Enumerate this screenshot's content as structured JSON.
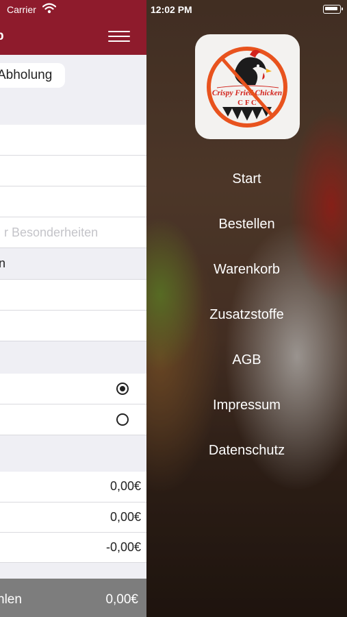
{
  "status": {
    "carrier": "Carrier",
    "time": "12:02 PM"
  },
  "navbar": {
    "title": "b"
  },
  "segment": {
    "label": "Abholung"
  },
  "fields": {
    "notes_placeholder": "r Besonderheiten",
    "text_row": "n"
  },
  "prices": [
    "0,00€",
    "0,00€",
    "-0,00€"
  ],
  "radios": {
    "first_selected": true
  },
  "footer": {
    "label": "hlen",
    "total": "0,00€"
  },
  "menu": {
    "items": [
      {
        "label": "Start"
      },
      {
        "label": "Bestellen"
      },
      {
        "label": "Warenkorb"
      },
      {
        "label": "Zusatzstoffe"
      },
      {
        "label": "AGB"
      },
      {
        "label": "Impressum"
      },
      {
        "label": "Datenschutz"
      }
    ]
  },
  "logo": {
    "text": "Crispy Fried Chicken",
    "abbr": "C F C"
  },
  "colors": {
    "brand": "#8e1b2c",
    "footer": "#7d7d7d",
    "logo_orange": "#e8531e"
  }
}
